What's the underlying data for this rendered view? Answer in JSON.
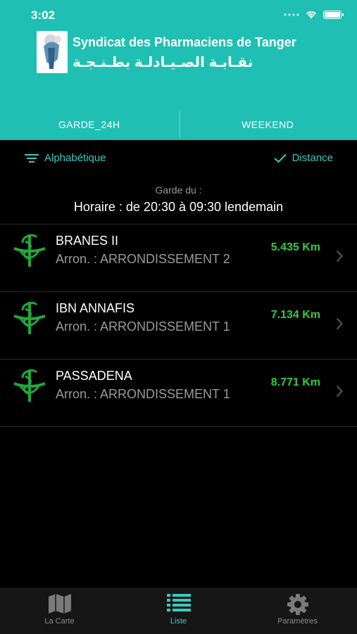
{
  "status": {
    "time": "3:02"
  },
  "header": {
    "title_fr": "Syndicat des Pharmaciens de Tanger",
    "title_ar": "نقـابـة الصـيـادلـة بطـنـجـة",
    "logo_icon": "syndicate-logo"
  },
  "tabs": [
    {
      "label": "GARDE_24H"
    },
    {
      "label": "WEEKEND"
    }
  ],
  "sort": {
    "alpha_label": "Alphabétique",
    "distance_label": "Distance"
  },
  "garde": {
    "label": "Garde du :",
    "horaire": "Horaire : de 20:30 à 09:30 lendemain"
  },
  "pharmacies": [
    {
      "name": "BRANES II",
      "arron": "Arron. : ARRONDISSEMENT 2",
      "distance": "5.435 Km"
    },
    {
      "name": "IBN ANNAFIS",
      "arron": "Arron. : ARRONDISSEMENT 1",
      "distance": "7.134 Km"
    },
    {
      "name": "PASSADENA",
      "arron": "Arron. : ARRONDISSEMENT 1",
      "distance": "8.771 Km"
    }
  ],
  "tabbar": [
    {
      "label": "La Carte",
      "icon": "map-icon"
    },
    {
      "label": "Liste",
      "icon": "list-icon"
    },
    {
      "label": "Paramètres",
      "icon": "gear-icon"
    }
  ],
  "colors": {
    "header": "#1fbfb3",
    "accent": "#3bc9c0",
    "distance": "#2ecc40",
    "background": "#000000"
  }
}
